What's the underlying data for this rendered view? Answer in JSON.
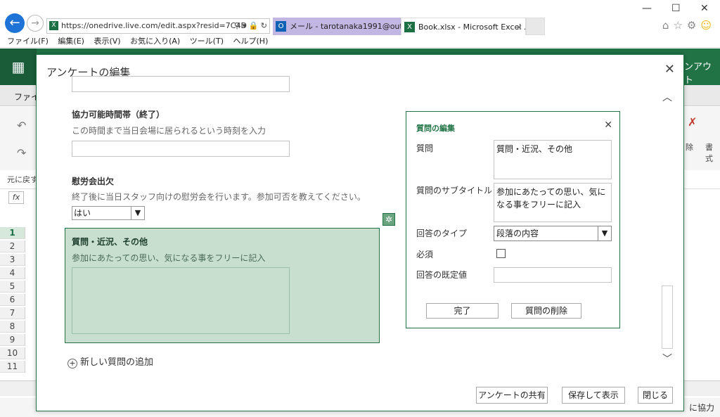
{
  "browser": {
    "address": "https://onedrive.live.com/edit.aspx?resid=7C4D",
    "tabs": [
      {
        "label": "メール - tarotanaka1991@outloo..."
      },
      {
        "label": "Book.xlsx - Microsoft Excel ..."
      }
    ],
    "menu": [
      "ファイル(F)",
      "編集(E)",
      "表示(V)",
      "お気に入り(A)",
      "ツール(T)",
      "ヘルプ(H)"
    ]
  },
  "excel": {
    "ribbon_tab": "ファイ",
    "header_right": "ンアウト",
    "undo_label": "元に戻す",
    "right_labels": [
      "除",
      "書式"
    ],
    "fx": "fx",
    "rows": [
      "1",
      "2",
      "3",
      "4",
      "5",
      "6",
      "7",
      "8",
      "9",
      "10",
      "11"
    ],
    "status_right": "に協力"
  },
  "modal": {
    "title": "アンケートの編集",
    "questions": [
      {
        "title": "協力可能時間帯（終了）",
        "subtitle": "この時間まで当日会場に居られるという時刻を入力"
      },
      {
        "title": "慰労会出欠",
        "subtitle": "終了後に当日スタッフ向けの慰労会を行います。参加可否を教えてください。",
        "select_value": "はい"
      }
    ],
    "selected_question": {
      "title": "質問・近況、その他",
      "subtitle": "参加にあたっての思い、気になる事をフリーに記入"
    },
    "add_question": "新しい質問の追加",
    "footer": {
      "share": "アンケートの共有",
      "save_view": "保存して表示",
      "close": "閉じる"
    }
  },
  "edit_panel": {
    "title": "質問の編集",
    "question_label": "質問",
    "question_value": "質問・近況、その他",
    "subtitle_label": "質問のサブタイトル",
    "subtitle_value": "参加にあたっての思い、気になる事をフリーに記入",
    "type_label": "回答のタイプ",
    "type_value": "段落の内容",
    "required_label": "必須",
    "required_checked": false,
    "default_label": "回答の既定値",
    "default_value": "",
    "done_button": "完了",
    "delete_button": "質問の削除"
  }
}
